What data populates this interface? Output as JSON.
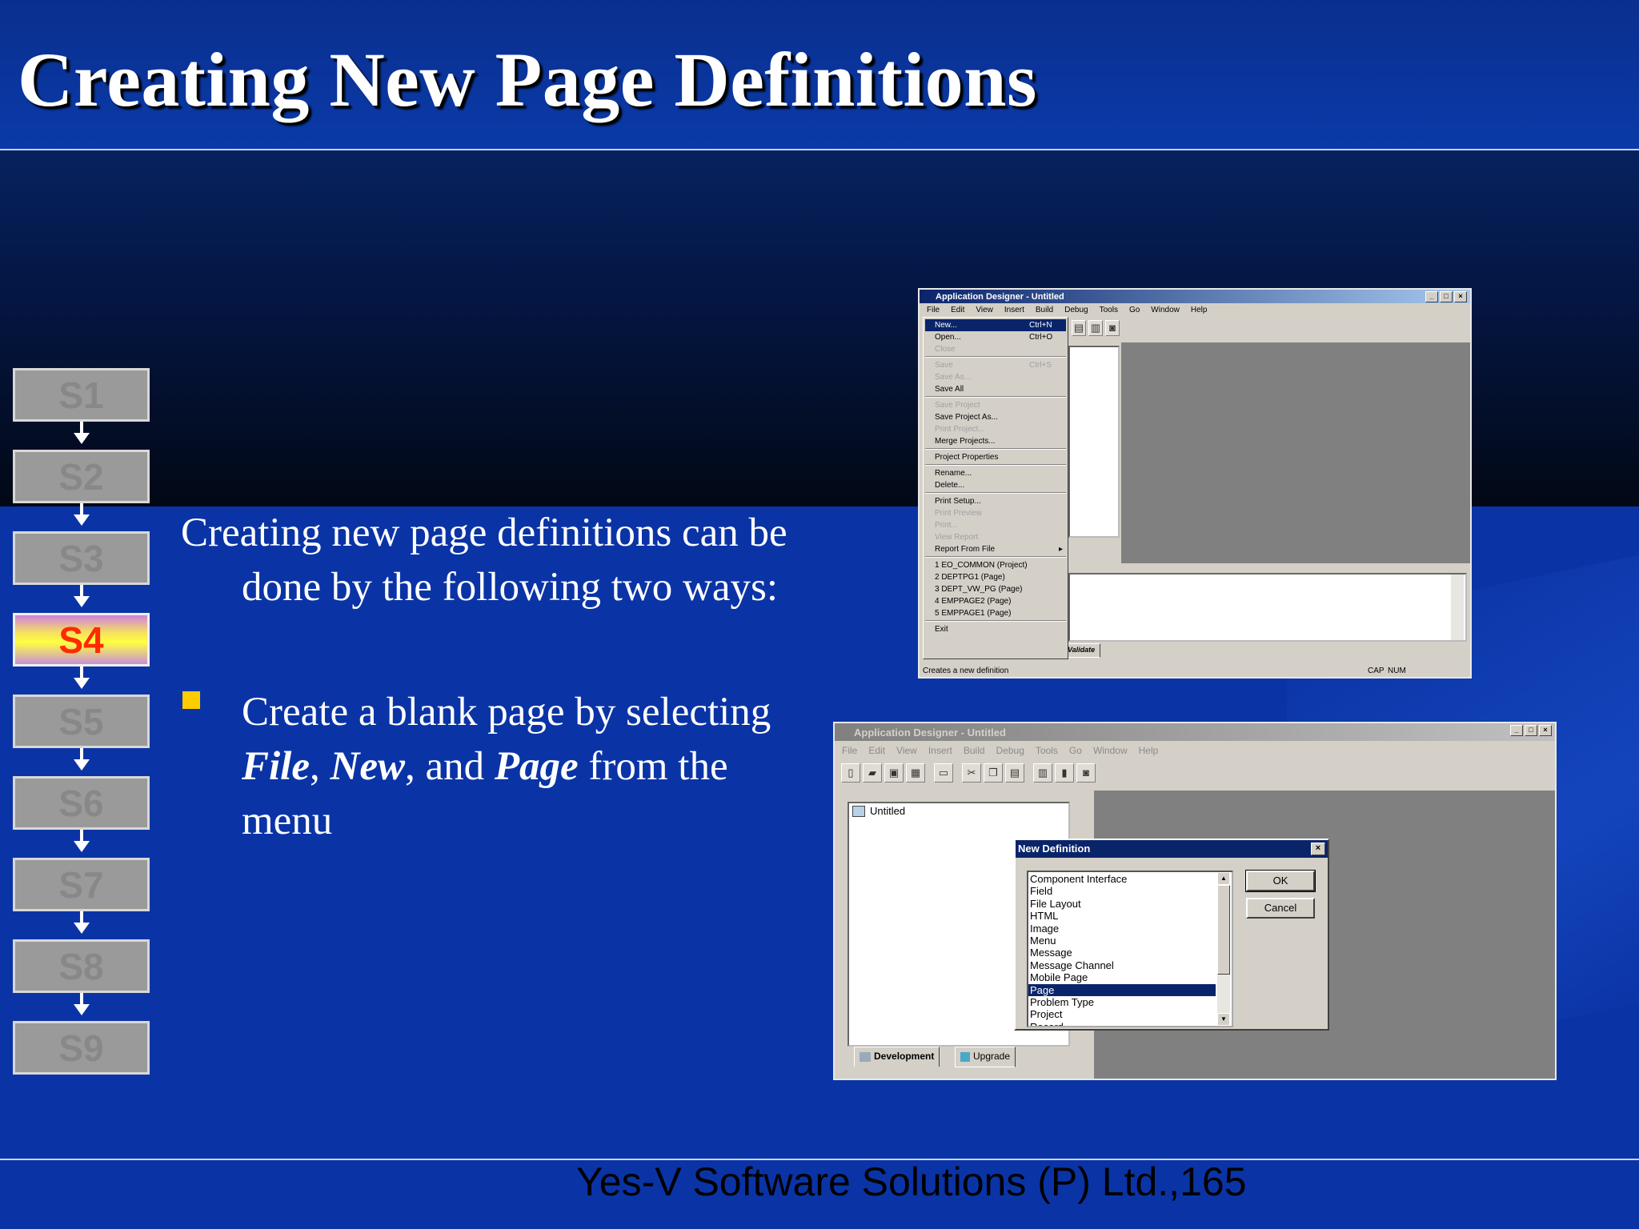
{
  "slide": {
    "title": "Creating New Page Definitions",
    "intro": "Creating new page definitions can be done by the following two ways:",
    "bullet": {
      "prefix": "Create a blank page by selecting ",
      "file": "File",
      "sep1": ", ",
      "new": "New",
      "sep2": ", and ",
      "page": "Page",
      "suffix": " from the menu"
    },
    "footer": "Yes-V Software Solutions (P) Ltd.,165",
    "colors": {
      "title": "#ffffff",
      "bullet": "#ffcc00",
      "active_step_text": "#ff2a00"
    }
  },
  "steps": [
    {
      "label": "S1",
      "active": false
    },
    {
      "label": "S2",
      "active": false
    },
    {
      "label": "S3",
      "active": false
    },
    {
      "label": "S4",
      "active": true
    },
    {
      "label": "S5",
      "active": false
    },
    {
      "label": "S6",
      "active": false
    },
    {
      "label": "S7",
      "active": false
    },
    {
      "label": "S8",
      "active": false
    },
    {
      "label": "S9",
      "active": false
    }
  ],
  "window1": {
    "title": "Application Designer - Untitled",
    "menu": [
      "File",
      "Edit",
      "View",
      "Insert",
      "Build",
      "Debug",
      "Tools",
      "Go",
      "Window",
      "Help"
    ],
    "file_menu": [
      {
        "label": "New...",
        "shortcut": "Ctrl+N",
        "state": "selected"
      },
      {
        "label": "Open...",
        "shortcut": "Ctrl+O",
        "state": "enabled"
      },
      {
        "label": "Close",
        "shortcut": "",
        "state": "disabled"
      },
      {
        "label": "Save",
        "shortcut": "Ctrl+S",
        "state": "disabled"
      },
      {
        "label": "Save As...",
        "shortcut": "",
        "state": "disabled"
      },
      {
        "label": "Save All",
        "shortcut": "",
        "state": "enabled"
      },
      {
        "label": "Save Project",
        "shortcut": "",
        "state": "disabled"
      },
      {
        "label": "Save Project As...",
        "shortcut": "",
        "state": "enabled"
      },
      {
        "label": "Print Project...",
        "shortcut": "",
        "state": "disabled"
      },
      {
        "label": "Merge Projects...",
        "shortcut": "",
        "state": "enabled"
      },
      {
        "label": "Project Properties",
        "shortcut": "",
        "state": "enabled"
      },
      {
        "label": "Rename...",
        "shortcut": "",
        "state": "enabled"
      },
      {
        "label": "Delete...",
        "shortcut": "",
        "state": "enabled"
      },
      {
        "label": "Print Setup...",
        "shortcut": "",
        "state": "enabled"
      },
      {
        "label": "Print Preview",
        "shortcut": "",
        "state": "disabled"
      },
      {
        "label": "Print...",
        "shortcut": "",
        "state": "disabled"
      },
      {
        "label": "View Report",
        "shortcut": "",
        "state": "disabled"
      },
      {
        "label": "Report From File",
        "shortcut": "",
        "state": "enabled"
      },
      {
        "label": "1 EO_COMMON (Project)",
        "shortcut": "",
        "state": "enabled"
      },
      {
        "label": "2 DEPTPG1 (Page)",
        "shortcut": "",
        "state": "enabled"
      },
      {
        "label": "3 DEPT_VW_PG (Page)",
        "shortcut": "",
        "state": "enabled"
      },
      {
        "label": "4 EMPPAGE2 (Page)",
        "shortcut": "",
        "state": "enabled"
      },
      {
        "label": "5 EMPPAGE1 (Page)",
        "shortcut": "",
        "state": "enabled"
      },
      {
        "label": "Exit",
        "shortcut": "",
        "state": "enabled"
      }
    ],
    "output_tab": "Validate",
    "status": "Creates a new definition",
    "status_cap": "CAP",
    "status_num": "NUM"
  },
  "window2": {
    "title": "Application Designer - Untitled",
    "menu": [
      "File",
      "Edit",
      "View",
      "Insert",
      "Build",
      "Debug",
      "Tools",
      "Go",
      "Window",
      "Help"
    ],
    "project_root": "Untitled",
    "tabs": [
      "Development",
      "Upgrade"
    ],
    "dialog": {
      "title": "New Definition",
      "items": [
        "Component Interface",
        "Field",
        "File Layout",
        "HTML",
        "Image",
        "Menu",
        "Message",
        "Message Channel",
        "Mobile Page",
        "Page",
        "Problem Type",
        "Project",
        "Record"
      ],
      "selected": "Page",
      "ok": "OK",
      "cancel": "Cancel"
    }
  }
}
